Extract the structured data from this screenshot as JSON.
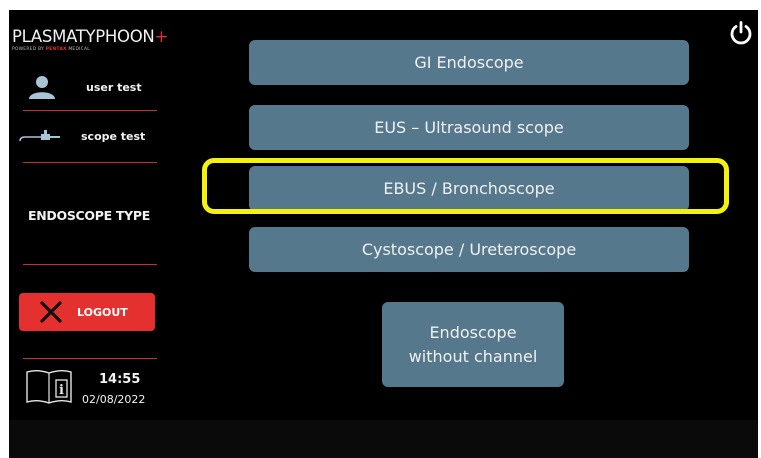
{
  "app": {
    "brand_main": "PLASMATYPHOON",
    "brand_plus": "+",
    "powered_prefix": "POWERED BY",
    "powered_brand": "PENTAX",
    "powered_suffix": "MEDICAL"
  },
  "sidebar": {
    "user_label": "user test",
    "scope_label": "scope test",
    "section_title": "ENDOSCOPE TYPE",
    "logout_label": "LOGOUT",
    "time": "14:55",
    "date": "02/08/2022"
  },
  "scope_types": {
    "gi": "GI Endoscope",
    "eus": "EUS – Ultrasound scope",
    "ebus": "EBUS / Bronchoscope",
    "cysto": "Cystoscope / Ureteroscope",
    "nochannel_line1": "Endoscope",
    "nochannel_line2": "without channel"
  },
  "selected": "EBUS / Bronchoscope",
  "colors": {
    "button": "#55788c",
    "accent_red": "#e53030",
    "highlight": "#f3f10e"
  }
}
